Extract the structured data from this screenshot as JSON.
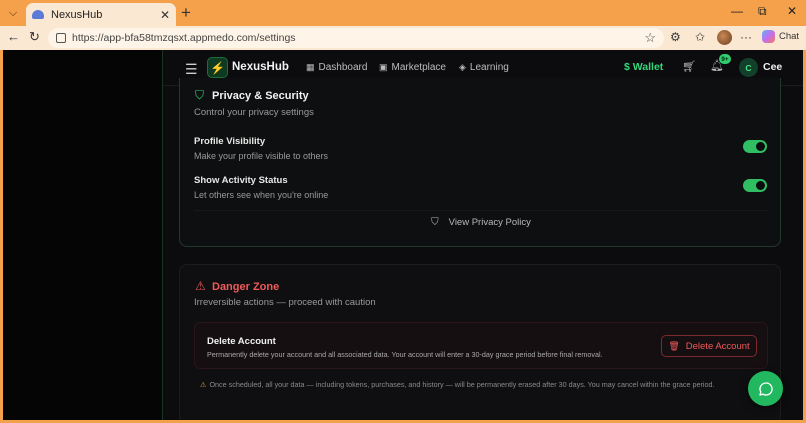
{
  "browser": {
    "tab_title": "NexusHub",
    "tab_close": "✕",
    "new_tab": "+",
    "url": "https://app-bfa58tmzqsxt.appmedo.com/settings",
    "chat_label": "Chat",
    "win_min": "—",
    "win_restore": "⧉",
    "win_close": "✕"
  },
  "header": {
    "brand": "NexusHub",
    "nav": [
      {
        "label": "Dashboard",
        "icon": "grid-icon"
      },
      {
        "label": "Marketplace",
        "icon": "bag-icon"
      },
      {
        "label": "Learning",
        "icon": "graduation-cap-icon"
      }
    ],
    "wallet_label": "Wallet",
    "notification_badge": "9+",
    "user_initial": "C",
    "user_name": "Cee"
  },
  "privacy": {
    "title": "Privacy & Security",
    "subtitle": "Control your privacy settings",
    "settings": [
      {
        "title": "Profile Visibility",
        "desc": "Make your profile visible to others",
        "enabled": true
      },
      {
        "title": "Show Activity Status",
        "desc": "Let others see when you're online",
        "enabled": true
      }
    ],
    "policy_link": "View Privacy Policy"
  },
  "danger": {
    "title": "Danger Zone",
    "subtitle": "Irreversible actions — proceed with caution",
    "delete_title": "Delete Account",
    "delete_desc": "Permanently delete your account and all associated data. Your account will enter a 30-day grace period before final removal.",
    "delete_button": "Delete Account",
    "warning": "Once scheduled, all your data — including tokens, purchases, and history — will be permanently erased after 30 days. You may cancel within the grace period."
  },
  "colors": {
    "accent": "#2fbf62",
    "danger": "#ef5a5a",
    "browser_frame": "#f5a04a"
  }
}
